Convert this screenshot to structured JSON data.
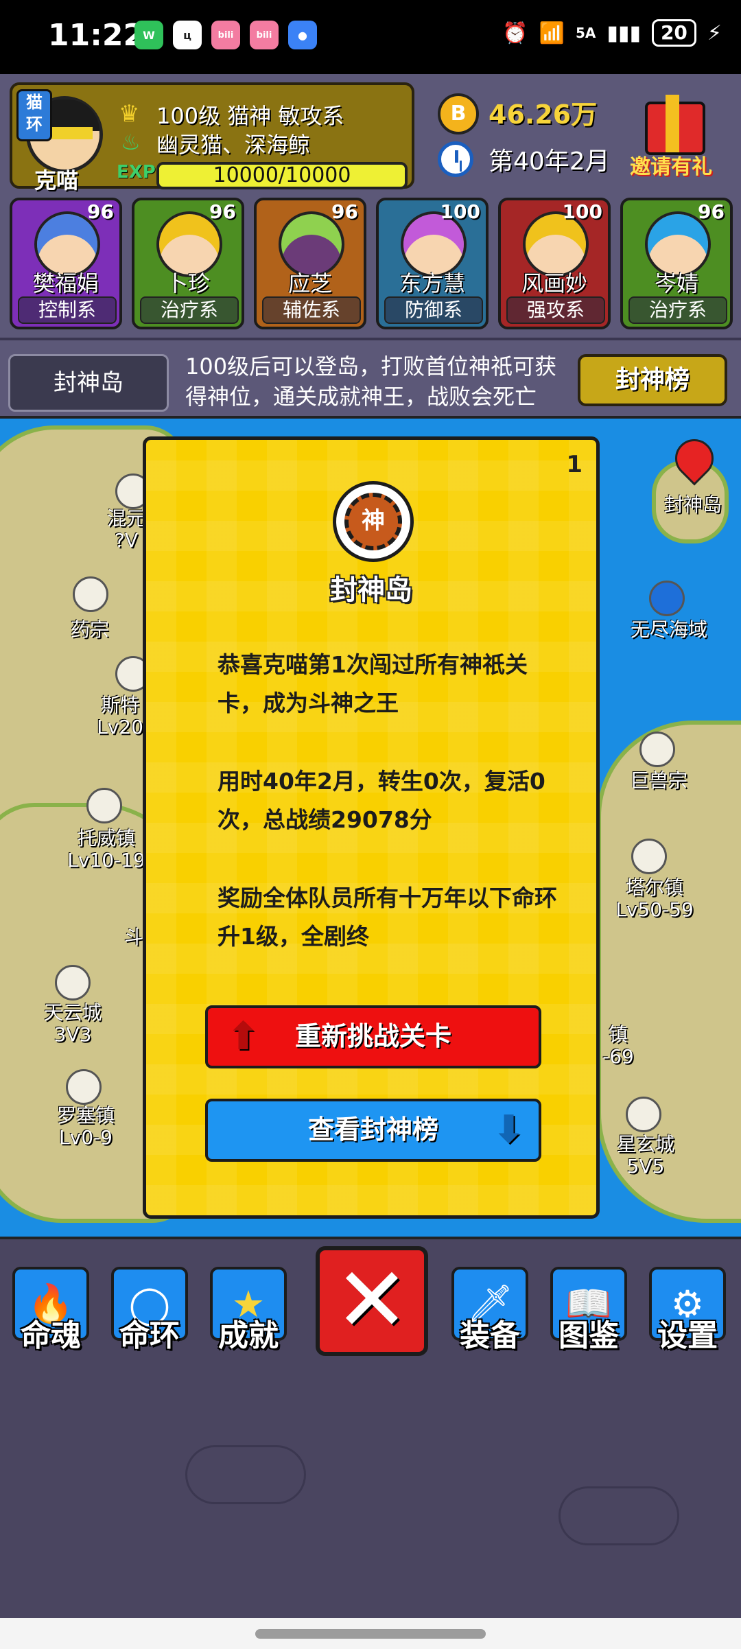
{
  "status_bar": {
    "time": "11:22",
    "network": "5A",
    "battery": "20",
    "apps": [
      {
        "icon": "wechat-icon",
        "label": "W",
        "color": "#2fc15a"
      },
      {
        "icon": "app-icon",
        "label": "ц",
        "color": "#ffffff"
      },
      {
        "icon": "bilibili-icon",
        "label": "bili",
        "color": "#f37ca1"
      },
      {
        "icon": "bilibili-icon",
        "label": "bili",
        "color": "#f37ca1"
      },
      {
        "icon": "message-icon",
        "label": "●",
        "color": "#3b82f6"
      }
    ]
  },
  "player": {
    "tag": "猫环",
    "name": "克喵",
    "title_line": "100级 猫神 敏攻系",
    "rings_line": "幽灵猫、深海鲸",
    "exp_tag": "EXP",
    "exp": "10000/10000",
    "money": "46.26万",
    "coin_symbol": "B",
    "date": "第40年2月",
    "gift_label": "邀请有礼"
  },
  "team": [
    {
      "name": "樊福娟",
      "level": "96",
      "role": "控制系",
      "color": "#7d2fb8"
    },
    {
      "name": "卜珍",
      "level": "96",
      "role": "治疗系",
      "color": "#4d8e22"
    },
    {
      "name": "应芝",
      "level": "96",
      "role": "辅佐系",
      "color": "#b1621a"
    },
    {
      "name": "东方慧",
      "level": "100",
      "role": "防御系",
      "color": "#2a6f97"
    },
    {
      "name": "风画妙",
      "level": "100",
      "role": "强攻系",
      "color": "#a52626"
    },
    {
      "name": "岑婧",
      "level": "96",
      "role": "治疗系",
      "color": "#4d8e22"
    }
  ],
  "location_bar": {
    "location": "封神岛",
    "info": "100级后可以登岛，打败首位神祇可获得神位，通关成就神王，战败会死亡",
    "rank_button": "封神榜"
  },
  "map": {
    "places": [
      {
        "name": "封神岛",
        "sub": ""
      },
      {
        "name": "无尽海域",
        "sub": ""
      },
      {
        "name": "混元",
        "sub": "?V"
      },
      {
        "name": "药宗",
        "sub": ""
      },
      {
        "name": "斯特",
        "sub": "Lv20"
      },
      {
        "name": "托威镇",
        "sub": "Lv10-19"
      },
      {
        "name": "巨兽宗",
        "sub": ""
      },
      {
        "name": "塔尔镇",
        "sub": "Lv50-59"
      },
      {
        "name": "天云城",
        "sub": "3V3"
      },
      {
        "name": "镇",
        "sub": "-69"
      },
      {
        "name": "罗塞镇",
        "sub": "Lv0-9"
      },
      {
        "name": "星玄城",
        "sub": "5V5"
      },
      {
        "name": "斗",
        "sub": ""
      }
    ]
  },
  "dialog": {
    "page": "1",
    "emblem": "神",
    "title": "封神岛",
    "paragraphs": [
      "恭喜克喵第1次闯过所有神祇关卡，成为斗神之王",
      "用时40年2月，转生0次，复活0次，总战绩29078分",
      "奖励全体队员所有十万年以下命环升1级，全剧终"
    ],
    "retry_button": "重新挑战关卡",
    "view_button": "查看封神榜"
  },
  "bottom_nav": {
    "items": [
      {
        "label": "命魂",
        "icon": "flame-icon",
        "glyph": "🔥"
      },
      {
        "label": "命环",
        "icon": "ring-icon",
        "glyph": "◯"
      },
      {
        "label": "成就",
        "icon": "star-icon",
        "glyph": "★"
      },
      {
        "label": "装备",
        "icon": "sword-icon",
        "glyph": "🗡"
      },
      {
        "label": "图鉴",
        "icon": "book-icon",
        "glyph": "📖"
      },
      {
        "label": "设置",
        "icon": "gear-icon",
        "glyph": "⚙"
      }
    ],
    "close": "✕"
  }
}
